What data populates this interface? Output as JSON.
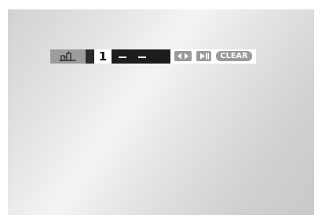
{
  "osd": {
    "angle_icon": "angle-camera-icon",
    "title_number": "1",
    "chapter_value": "– –",
    "buttons": {
      "left_right_icon": "left-right-arrows-icon",
      "skip_icon": "skip-next-icon",
      "clear_label": "CLEAR"
    }
  },
  "colors": {
    "bar_background": "#ffffff",
    "angle_box": "#9d9d9d",
    "chapter_box": "#1d1d1d",
    "button_fill": "#9a9a9a"
  }
}
